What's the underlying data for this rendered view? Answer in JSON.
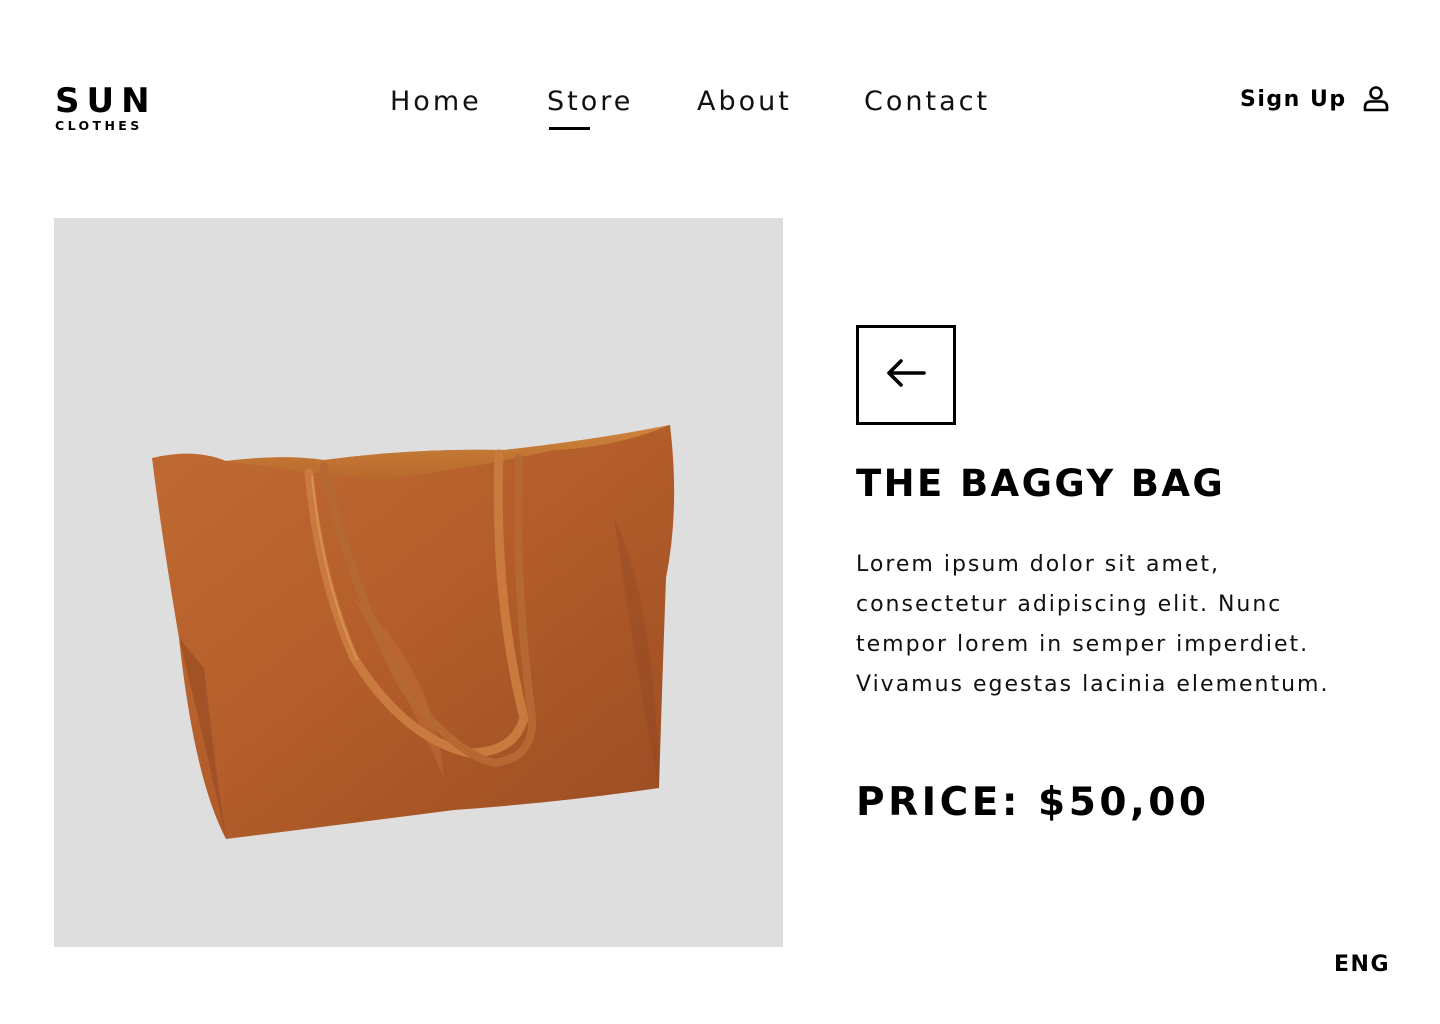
{
  "brand": {
    "name": "SUN",
    "tagline": "CLOTHES"
  },
  "nav": {
    "items": [
      {
        "label": "Home"
      },
      {
        "label": "Store",
        "active": true
      },
      {
        "label": "About"
      },
      {
        "label": "Contact"
      }
    ]
  },
  "account": {
    "signup_label": "Sign Up",
    "icon": "user-icon"
  },
  "product": {
    "title": "THE BAGGY BAG",
    "description": "Lorem ipsum dolor sit amet, consectetur adipiscing elit. Nunc tempor lorem in semper imperdiet. Vivamus egestas lacinia elementum.",
    "price": "PRICE: $50,00",
    "image": {
      "subject": "brown leather tote bag",
      "background": "#dedede"
    }
  },
  "back_button": {
    "icon": "arrow-left-icon"
  },
  "footer": {
    "language": "ENG"
  },
  "colors": {
    "text": "#000000",
    "image_bg": "#dedede",
    "leather": "#b5602b"
  }
}
